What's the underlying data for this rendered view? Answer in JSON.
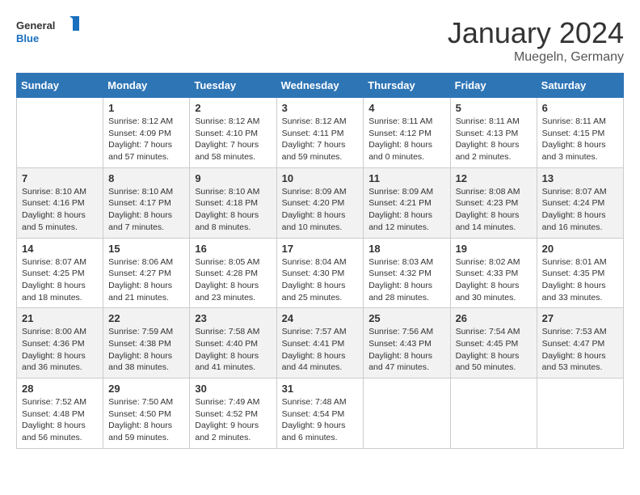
{
  "logo": {
    "general": "General",
    "blue": "Blue"
  },
  "title": "January 2024",
  "location": "Muegeln, Germany",
  "days_header": [
    "Sunday",
    "Monday",
    "Tuesday",
    "Wednesday",
    "Thursday",
    "Friday",
    "Saturday"
  ],
  "weeks": [
    [
      {
        "day": "",
        "info": ""
      },
      {
        "day": "1",
        "info": "Sunrise: 8:12 AM\nSunset: 4:09 PM\nDaylight: 7 hours\nand 57 minutes."
      },
      {
        "day": "2",
        "info": "Sunrise: 8:12 AM\nSunset: 4:10 PM\nDaylight: 7 hours\nand 58 minutes."
      },
      {
        "day": "3",
        "info": "Sunrise: 8:12 AM\nSunset: 4:11 PM\nDaylight: 7 hours\nand 59 minutes."
      },
      {
        "day": "4",
        "info": "Sunrise: 8:11 AM\nSunset: 4:12 PM\nDaylight: 8 hours\nand 0 minutes."
      },
      {
        "day": "5",
        "info": "Sunrise: 8:11 AM\nSunset: 4:13 PM\nDaylight: 8 hours\nand 2 minutes."
      },
      {
        "day": "6",
        "info": "Sunrise: 8:11 AM\nSunset: 4:15 PM\nDaylight: 8 hours\nand 3 minutes."
      }
    ],
    [
      {
        "day": "7",
        "info": "Sunrise: 8:10 AM\nSunset: 4:16 PM\nDaylight: 8 hours\nand 5 minutes."
      },
      {
        "day": "8",
        "info": "Sunrise: 8:10 AM\nSunset: 4:17 PM\nDaylight: 8 hours\nand 7 minutes."
      },
      {
        "day": "9",
        "info": "Sunrise: 8:10 AM\nSunset: 4:18 PM\nDaylight: 8 hours\nand 8 minutes."
      },
      {
        "day": "10",
        "info": "Sunrise: 8:09 AM\nSunset: 4:20 PM\nDaylight: 8 hours\nand 10 minutes."
      },
      {
        "day": "11",
        "info": "Sunrise: 8:09 AM\nSunset: 4:21 PM\nDaylight: 8 hours\nand 12 minutes."
      },
      {
        "day": "12",
        "info": "Sunrise: 8:08 AM\nSunset: 4:23 PM\nDaylight: 8 hours\nand 14 minutes."
      },
      {
        "day": "13",
        "info": "Sunrise: 8:07 AM\nSunset: 4:24 PM\nDaylight: 8 hours\nand 16 minutes."
      }
    ],
    [
      {
        "day": "14",
        "info": "Sunrise: 8:07 AM\nSunset: 4:25 PM\nDaylight: 8 hours\nand 18 minutes."
      },
      {
        "day": "15",
        "info": "Sunrise: 8:06 AM\nSunset: 4:27 PM\nDaylight: 8 hours\nand 21 minutes."
      },
      {
        "day": "16",
        "info": "Sunrise: 8:05 AM\nSunset: 4:28 PM\nDaylight: 8 hours\nand 23 minutes."
      },
      {
        "day": "17",
        "info": "Sunrise: 8:04 AM\nSunset: 4:30 PM\nDaylight: 8 hours\nand 25 minutes."
      },
      {
        "day": "18",
        "info": "Sunrise: 8:03 AM\nSunset: 4:32 PM\nDaylight: 8 hours\nand 28 minutes."
      },
      {
        "day": "19",
        "info": "Sunrise: 8:02 AM\nSunset: 4:33 PM\nDaylight: 8 hours\nand 30 minutes."
      },
      {
        "day": "20",
        "info": "Sunrise: 8:01 AM\nSunset: 4:35 PM\nDaylight: 8 hours\nand 33 minutes."
      }
    ],
    [
      {
        "day": "21",
        "info": "Sunrise: 8:00 AM\nSunset: 4:36 PM\nDaylight: 8 hours\nand 36 minutes."
      },
      {
        "day": "22",
        "info": "Sunrise: 7:59 AM\nSunset: 4:38 PM\nDaylight: 8 hours\nand 38 minutes."
      },
      {
        "day": "23",
        "info": "Sunrise: 7:58 AM\nSunset: 4:40 PM\nDaylight: 8 hours\nand 41 minutes."
      },
      {
        "day": "24",
        "info": "Sunrise: 7:57 AM\nSunset: 4:41 PM\nDaylight: 8 hours\nand 44 minutes."
      },
      {
        "day": "25",
        "info": "Sunrise: 7:56 AM\nSunset: 4:43 PM\nDaylight: 8 hours\nand 47 minutes."
      },
      {
        "day": "26",
        "info": "Sunrise: 7:54 AM\nSunset: 4:45 PM\nDaylight: 8 hours\nand 50 minutes."
      },
      {
        "day": "27",
        "info": "Sunrise: 7:53 AM\nSunset: 4:47 PM\nDaylight: 8 hours\nand 53 minutes."
      }
    ],
    [
      {
        "day": "28",
        "info": "Sunrise: 7:52 AM\nSunset: 4:48 PM\nDaylight: 8 hours\nand 56 minutes."
      },
      {
        "day": "29",
        "info": "Sunrise: 7:50 AM\nSunset: 4:50 PM\nDaylight: 8 hours\nand 59 minutes."
      },
      {
        "day": "30",
        "info": "Sunrise: 7:49 AM\nSunset: 4:52 PM\nDaylight: 9 hours\nand 2 minutes."
      },
      {
        "day": "31",
        "info": "Sunrise: 7:48 AM\nSunset: 4:54 PM\nDaylight: 9 hours\nand 6 minutes."
      },
      {
        "day": "",
        "info": ""
      },
      {
        "day": "",
        "info": ""
      },
      {
        "day": "",
        "info": ""
      }
    ]
  ]
}
